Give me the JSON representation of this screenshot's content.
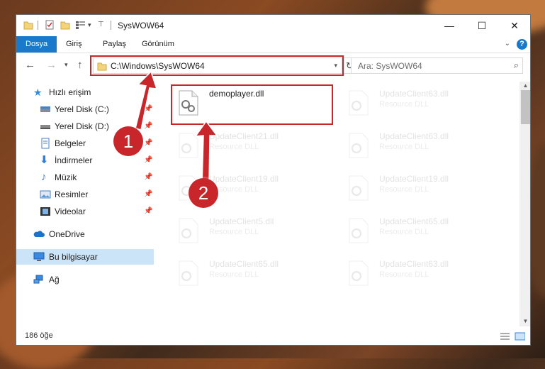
{
  "window": {
    "title": "SysWOW64"
  },
  "ribbon": {
    "tabs": [
      "Dosya",
      "Giriş",
      "Paylaş",
      "Görünüm"
    ],
    "help": "?"
  },
  "address": {
    "path": "C:\\Windows\\SysWOW64"
  },
  "search": {
    "placeholder": "Ara: SysWOW64"
  },
  "nav": {
    "items": [
      {
        "label": "Hızlı erişim",
        "icon": "star-icon"
      },
      {
        "label": "Yerel Disk (C:)",
        "icon": "drive-icon"
      },
      {
        "label": "Yerel Disk (D:)",
        "icon": "drive-icon"
      },
      {
        "label": "Belgeler",
        "icon": "documents-icon"
      },
      {
        "label": "İndirmeler",
        "icon": "download-icon"
      },
      {
        "label": "Müzik",
        "icon": "music-icon"
      },
      {
        "label": "Resimler",
        "icon": "pictures-icon"
      },
      {
        "label": "Videolar",
        "icon": "video-icon"
      },
      {
        "label": "OneDrive",
        "icon": "cloud-icon"
      },
      {
        "label": "Bu bilgisayar",
        "icon": "computer-icon"
      },
      {
        "label": "Ağ",
        "icon": "network-icon"
      }
    ]
  },
  "files": [
    {
      "name": "demoplayer.dll",
      "type": ""
    },
    {
      "name": "UpdateClient63.dll",
      "type": "Resource DLL"
    },
    {
      "name": "UpdateClient21.dll",
      "type": "Resource DLL"
    },
    {
      "name": "UpdateClient63.dll",
      "type": "Resource DLL"
    },
    {
      "name": "UpdateClient19.dll",
      "type": "Resource DLL"
    },
    {
      "name": "UpdateClient19.dll",
      "type": "Resource DLL"
    },
    {
      "name": "UpdateClient5.dll",
      "type": "Resource DLL"
    },
    {
      "name": "UpdateClient65.dll",
      "type": "Resource DLL"
    },
    {
      "name": "UpdateClient65.dll",
      "type": "Resource DLL"
    },
    {
      "name": "UpdateClient63.dll",
      "type": "Resource DLL"
    }
  ],
  "status": {
    "count": "186 öğe"
  },
  "annotations": {
    "step1": "1",
    "step2": "2"
  },
  "colors": {
    "accent": "#1979ca",
    "highlight": "#c8262b",
    "selection": "#cce4f7"
  }
}
